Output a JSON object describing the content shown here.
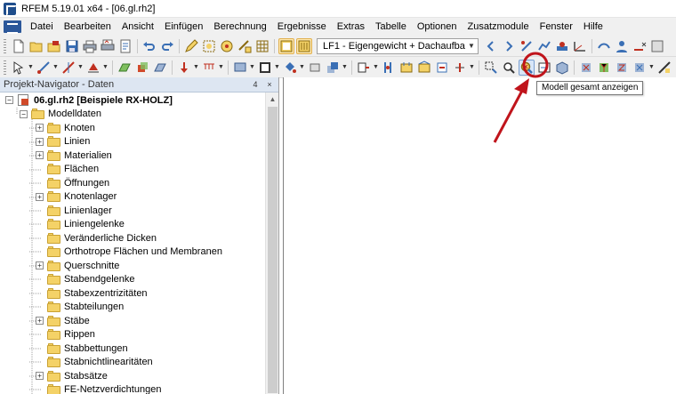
{
  "window": {
    "title": "RFEM 5.19.01 x64 - [06.gl.rh2]"
  },
  "menu": {
    "items": [
      {
        "label": "Datei"
      },
      {
        "label": "Bearbeiten"
      },
      {
        "label": "Ansicht"
      },
      {
        "label": "Einfügen"
      },
      {
        "label": "Berechnung"
      },
      {
        "label": "Ergebnisse"
      },
      {
        "label": "Extras"
      },
      {
        "label": "Tabelle"
      },
      {
        "label": "Optionen"
      },
      {
        "label": "Zusatzmodule"
      },
      {
        "label": "Fenster"
      },
      {
        "label": "Hilfe"
      }
    ]
  },
  "toolbar": {
    "load_case": "LF1 - Eigengewicht + Dachaufbau"
  },
  "navigator": {
    "title": "Projekt-Navigator - Daten",
    "pin_label": "4",
    "close_label": "×",
    "project": "06.gl.rh2 [Beispiele RX-HOLZ]",
    "model_data": "Modelldaten",
    "items": [
      {
        "label": "Knoten"
      },
      {
        "label": "Linien"
      },
      {
        "label": "Materialien"
      },
      {
        "label": "Flächen"
      },
      {
        "label": "Öffnungen"
      },
      {
        "label": "Knotenlager"
      },
      {
        "label": "Linienlager"
      },
      {
        "label": "Liniengelenke"
      },
      {
        "label": "Veränderliche Dicken"
      },
      {
        "label": "Orthotrope Flächen und Membranen"
      },
      {
        "label": "Querschnitte"
      },
      {
        "label": "Stabendgelenke"
      },
      {
        "label": "Stabexzentrizitäten"
      },
      {
        "label": "Stabteilungen"
      },
      {
        "label": "Stäbe"
      },
      {
        "label": "Rippen"
      },
      {
        "label": "Stabbettungen"
      },
      {
        "label": "Stabnichtlinearitäten"
      },
      {
        "label": "Stabsätze"
      },
      {
        "label": "FE-Netzverdichtungen"
      }
    ]
  },
  "tooltip": {
    "text": "Modell gesamt anzeigen"
  },
  "colors": {
    "annotation": "#c0141b",
    "folder": "#f4d267"
  }
}
